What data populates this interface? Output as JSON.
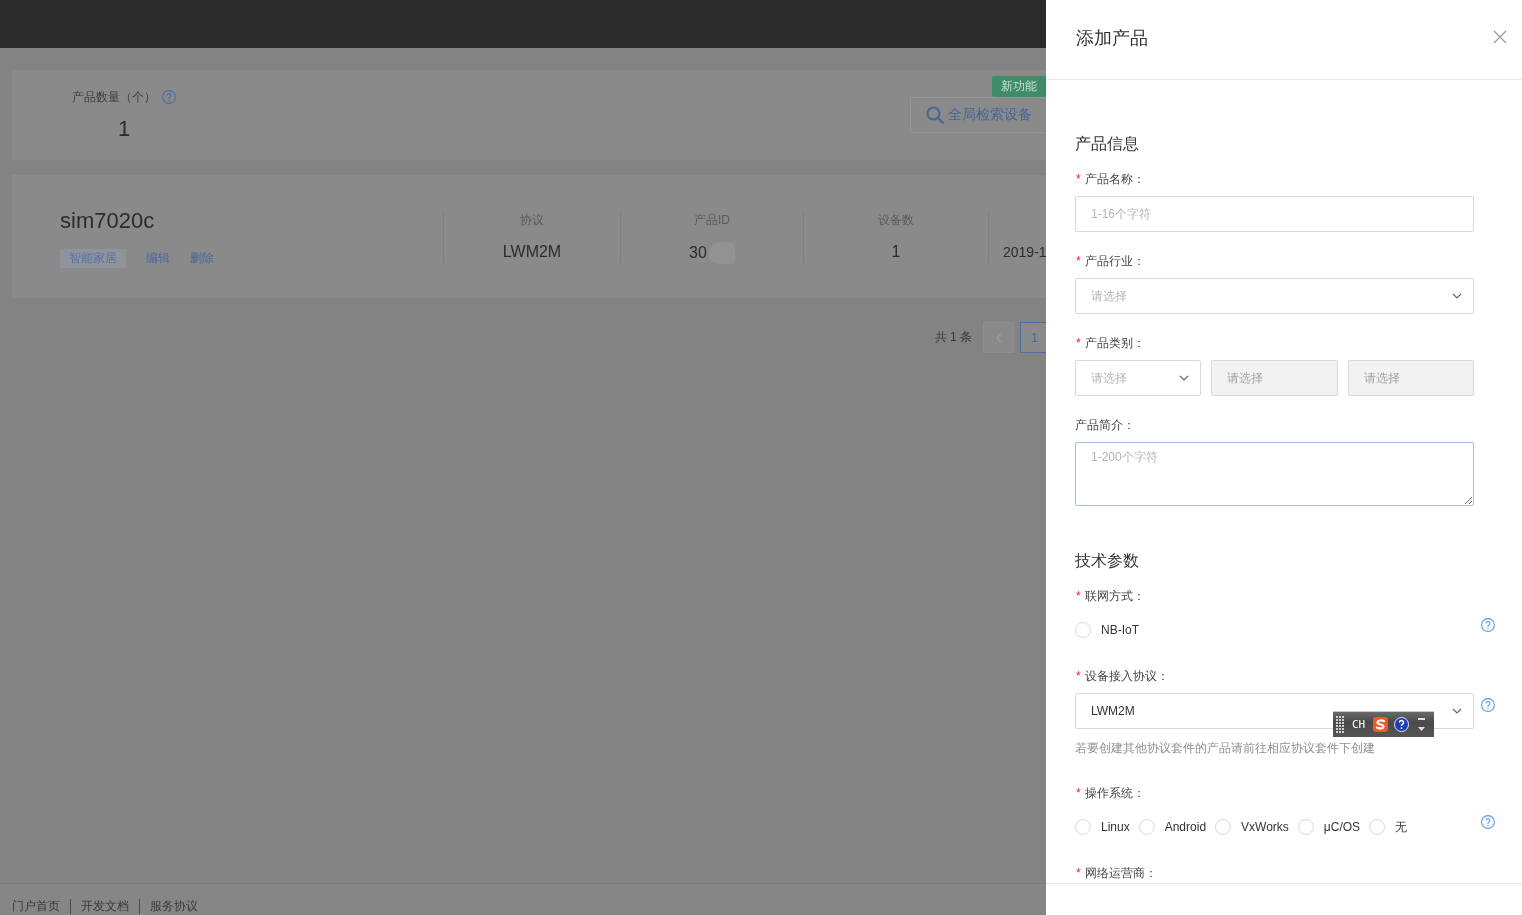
{
  "summary_card": {
    "label": "产品数量（个）",
    "value": "1",
    "badge": "新功能",
    "search_button": "全局检索设备"
  },
  "product_card": {
    "name": "sim7020c",
    "tag": "智能家居",
    "actions": [
      "编辑",
      "删除"
    ],
    "columns": [
      {
        "header": "协议",
        "value": "LWM2M",
        "redacted": false
      },
      {
        "header": "产品ID",
        "value": "30",
        "redacted": true
      },
      {
        "header": "设备数",
        "value": "1",
        "redacted": false
      },
      {
        "value": "2019-1",
        "redacted": false
      }
    ]
  },
  "pagination": {
    "total": "共 1 条",
    "prev_disabled": true,
    "pages": [
      {
        "label": "1",
        "selected": true
      }
    ]
  },
  "footer_links": [
    "门户首页",
    "开发文档",
    "服务协议"
  ],
  "drawer": {
    "title": "添加产品",
    "sections": [
      {
        "title": "产品信息",
        "fields": [
          {
            "kind": "input",
            "required_mark": "*",
            "label": "产品名称：",
            "placeholder": "1-16个字符"
          },
          {
            "kind": "select",
            "required_mark": "*",
            "label": "产品行业：",
            "placeholder": "请选择"
          },
          {
            "kind": "cascade",
            "required_mark": "*",
            "label": "产品类别：",
            "selects": [
              {
                "placeholder": "请选择",
                "disabled": false
              },
              {
                "placeholder": "请选择",
                "disabled": true
              },
              {
                "placeholder": "请选择",
                "disabled": true
              }
            ]
          },
          {
            "kind": "textarea",
            "label": "产品简介：",
            "placeholder": "1-200个字符",
            "focused": true
          }
        ]
      },
      {
        "title": "技术参数",
        "fields": [
          {
            "kind": "radio",
            "required_mark": "*",
            "label": "联网方式：",
            "help": true,
            "options": [
              {
                "label": "NB-IoT",
                "selected": false
              }
            ]
          },
          {
            "kind": "select",
            "required_mark": "*",
            "label": "设备接入协议：",
            "value": "LWM2M",
            "help": true,
            "hint": "若要创建其他协议套件的产品请前往相应协议套件下创建"
          },
          {
            "kind": "radio",
            "required_mark": "*",
            "label": "操作系统：",
            "help": true,
            "options": [
              {
                "label": "Linux",
                "selected": false
              },
              {
                "label": "Android",
                "selected": false
              },
              {
                "label": "VxWorks",
                "selected": false
              },
              {
                "label": "μC/OS",
                "selected": false
              },
              {
                "label": "无",
                "selected": false
              }
            ]
          },
          {
            "kind": "label",
            "required_mark": "*",
            "label": "网络运营商："
          }
        ]
      }
    ]
  },
  "ime_toolbar": {
    "mode": "CH"
  }
}
